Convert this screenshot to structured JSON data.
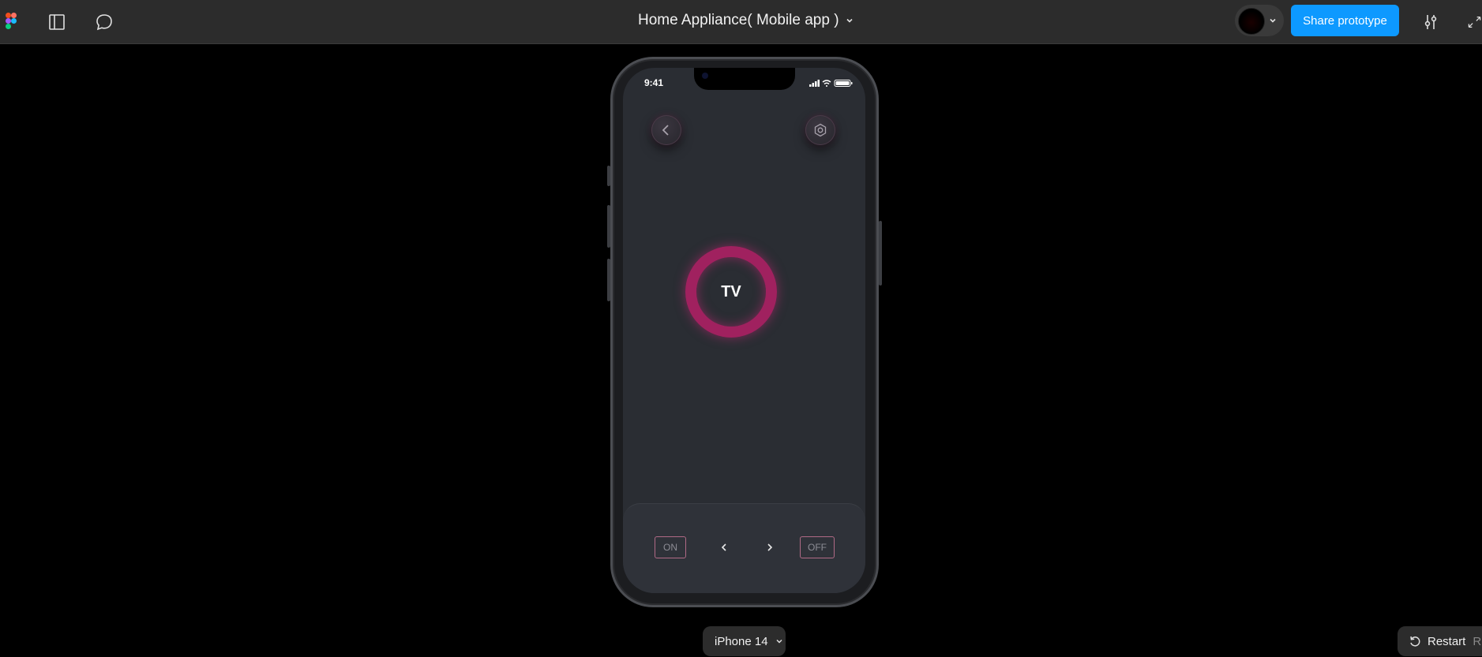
{
  "topbar": {
    "title": "Home Appliance( Mobile app )",
    "share_label": "Share prototype",
    "icons": [
      "figma-logo",
      "sidebar-icon",
      "comment-icon",
      "chevron-down-icon",
      "avatar",
      "settings-sliders-icon",
      "expand-icon"
    ]
  },
  "phone": {
    "time": "9:41",
    "tv_label": "TV",
    "on_label": "ON",
    "off_label": "OFF",
    "accent_color": "#a0215f",
    "screen_color": "#2a2d33"
  },
  "footer": {
    "device_label": "iPhone 14",
    "restart_label": "Restart",
    "restart_shortcut": "R"
  },
  "colors": {
    "topbar": "#2c2c2c",
    "share_button": "#0d99ff",
    "background": "#000000"
  }
}
